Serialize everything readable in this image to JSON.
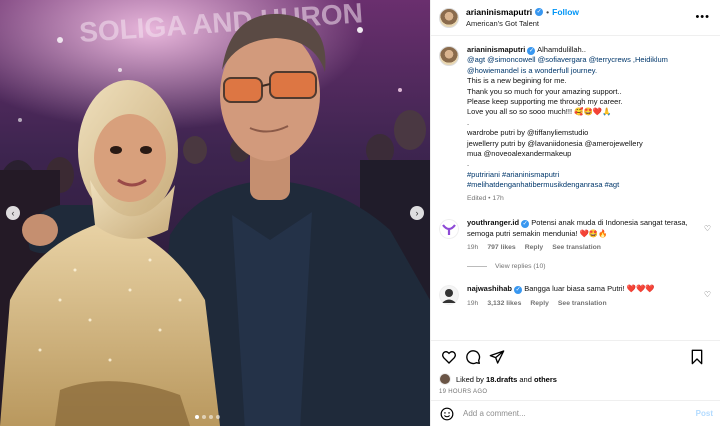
{
  "photo": {
    "stage_text": "SOLIGA AND HURON",
    "slide_count": 4,
    "active_slide": 1
  },
  "header": {
    "username": "arianinismaputri",
    "separator": "•",
    "follow_label": "Follow",
    "subtitle": "American's Got Talent",
    "more": "•••"
  },
  "caption": {
    "username": "arianinismaputri",
    "lines": [
      "Alhamdulillah..",
      "@agt @simoncowell @sofiavergara @terrycrews ,Heidiklum",
      "@howiemandel is a wonderfull journey.",
      "This is a new begining for me.",
      "",
      "Thank you so much for your amazing support..",
      "Please keep supporting me through my career.",
      "Love you all so so sooo much!!! 🥰🤩❤️🙏",
      ".",
      "wardrobe putri by @tiffanyliemstudio",
      "jewellerry putri by @lavaniidonesia @amerojewellery",
      "mua @noveoalexandermakeup",
      ".",
      "#putririani #arianinismaputri",
      "#melihatdenganhatibermusikdenganrasa #agt"
    ],
    "edited": "Edited • 17h"
  },
  "comments": [
    {
      "username": "youthranger.id",
      "text": "Potensi anak muda di Indonesia sangat terasa, semoga putri semakin mendunia! ❤️🤩🔥",
      "time": "19h",
      "likes": "797 likes",
      "reply": "Reply",
      "translate": "See translation",
      "view_replies": "View replies (10)"
    },
    {
      "username": "najwashihab",
      "text": "Bangga luar biasa sama Putri! ❤️❤️❤️",
      "time": "19h",
      "likes": "3,132 likes",
      "reply": "Reply",
      "translate": "See translation"
    }
  ],
  "actions": {
    "liked_prefix": "Liked by ",
    "liked_by": "18.drafts",
    "liked_and": " and ",
    "liked_others": "others",
    "ago": "19 HOURS AGO"
  },
  "add_comment": {
    "placeholder": "Add a comment...",
    "post_label": "Post"
  },
  "colors": {
    "link": "#00376b",
    "follow": "#0095f6",
    "verified": "#3897f0",
    "heart": "#ed4956"
  },
  "icons": [
    "chevron-left-icon",
    "chevron-right-icon",
    "verified-badge-icon",
    "more-icon",
    "heart-icon",
    "comment-icon",
    "share-icon",
    "bookmark-icon",
    "emoji-icon"
  ]
}
